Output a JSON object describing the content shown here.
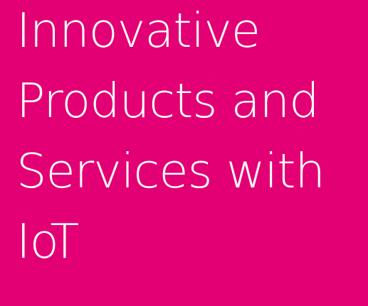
{
  "hero": {
    "background_color": "#E20074",
    "text_color": "#FFFFFF",
    "headline_lines": [
      "Innovative",
      "Products and",
      "Services with",
      "IoT"
    ]
  }
}
